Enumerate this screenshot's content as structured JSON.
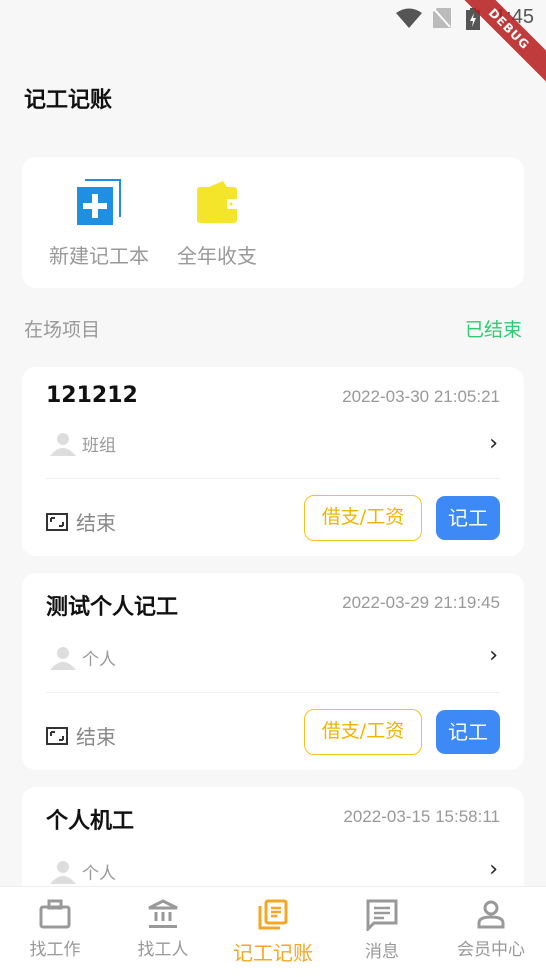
{
  "status_bar": {
    "time": "1:45",
    "debug_banner": "DEBUG",
    "icons": [
      "wifi-icon",
      "no-sim-icon",
      "battery-charging-icon"
    ]
  },
  "header": {
    "title": "记工记账"
  },
  "quick_actions": [
    {
      "label": "新建记工本",
      "icon": "new-book-icon",
      "color": "#1e8fe1"
    },
    {
      "label": "全年收支",
      "icon": "wallet-icon",
      "color": "#f5e52a"
    }
  ],
  "section": {
    "label": "在场项目",
    "ended_link": "已结束"
  },
  "projects": [
    {
      "name": "121212",
      "date": "2022-03-30 21:05:21",
      "type": "班组",
      "end_label": "结束",
      "loan_label": "借支/工资",
      "record_label": "记工"
    },
    {
      "name": "测试个人记工",
      "date": "2022-03-29 21:19:45",
      "type": "个人",
      "end_label": "结束",
      "loan_label": "借支/工资",
      "record_label": "记工"
    },
    {
      "name": "个人机工",
      "date": "2022-03-15 15:58:11",
      "type": "个人"
    }
  ],
  "bottom_nav": [
    {
      "label": "找工作",
      "icon": "briefcase-icon"
    },
    {
      "label": "找工人",
      "icon": "bank-icon"
    },
    {
      "label": "记工记账",
      "icon": "ledger-icon",
      "active": true
    },
    {
      "label": "消息",
      "icon": "message-icon"
    },
    {
      "label": "会员中心",
      "icon": "user-icon"
    }
  ],
  "colors": {
    "accent": "#f5a623",
    "primary_button": "#3d8af7",
    "ended": "#2ecc71",
    "loan_border": "#f5c518"
  }
}
